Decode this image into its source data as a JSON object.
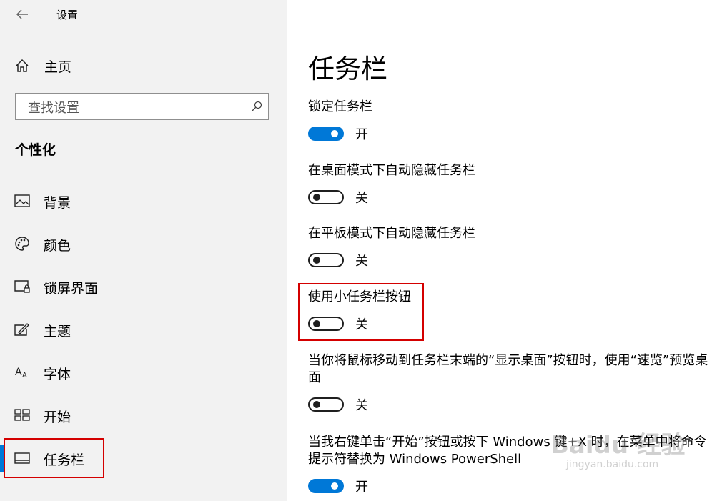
{
  "window": {
    "title": "设置"
  },
  "sidebar": {
    "home_label": "主页",
    "search_placeholder": "查找设置",
    "section_heading": "个性化",
    "items": [
      {
        "label": "背景",
        "icon": "picture-icon"
      },
      {
        "label": "颜色",
        "icon": "palette-icon"
      },
      {
        "label": "锁屏界面",
        "icon": "lock-screen-icon"
      },
      {
        "label": "主题",
        "icon": "theme-icon"
      },
      {
        "label": "字体",
        "icon": "font-icon"
      },
      {
        "label": "开始",
        "icon": "start-icon"
      },
      {
        "label": "任务栏",
        "icon": "taskbar-icon",
        "active": true
      }
    ]
  },
  "main": {
    "page_title": "任务栏",
    "settings": [
      {
        "label": "锁定任务栏",
        "state": "开",
        "on": true
      },
      {
        "label": "在桌面模式下自动隐藏任务栏",
        "state": "关",
        "on": false
      },
      {
        "label": "在平板模式下自动隐藏任务栏",
        "state": "关",
        "on": false
      },
      {
        "label": "使用小任务栏按钮",
        "state": "关",
        "on": false
      },
      {
        "label": "当你将鼠标移动到任务栏末端的“显示桌面”按钮时，使用“速览”预览桌面",
        "state": "关",
        "on": false
      },
      {
        "label": "当我右键单击“开始”按钮或按下 Windows 键+X 时，在菜单中将命令提示符替换为 Windows PowerShell",
        "state": "开",
        "on": true
      }
    ]
  },
  "watermark": {
    "brand": "Baidu 经验",
    "url": "jingyan.baidu.com"
  },
  "colors": {
    "accent": "#0078d7",
    "highlight": "#d40000",
    "sidebar_bg": "#f2f2f2"
  }
}
